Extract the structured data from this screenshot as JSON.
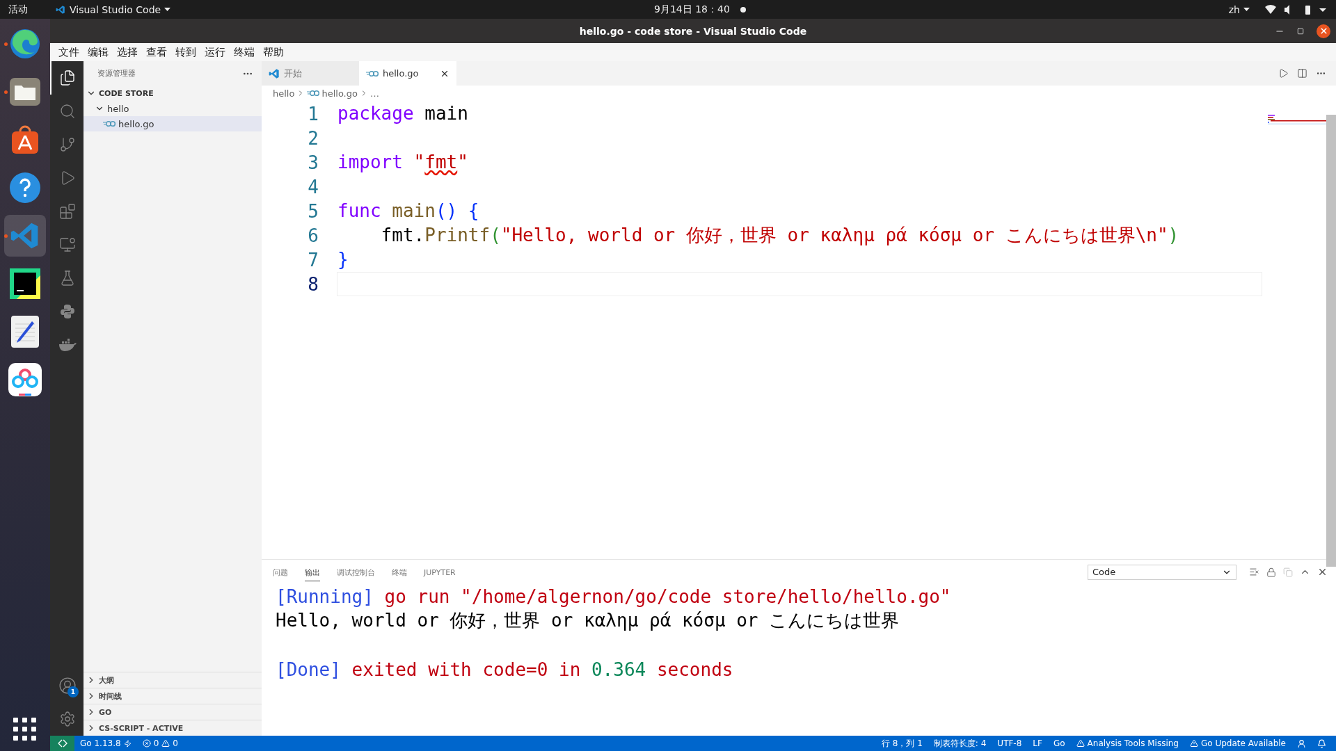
{
  "system_bar": {
    "activities": "活动",
    "app_name": "Visual Studio Code",
    "clock": "9月14日  18：40",
    "input_method": "zh"
  },
  "dock": {
    "apps": [
      {
        "kind": "edge",
        "running": true,
        "selected": false
      },
      {
        "kind": "files",
        "running": true,
        "selected": false
      },
      {
        "kind": "software",
        "running": false,
        "selected": false
      },
      {
        "kind": "help",
        "running": false,
        "selected": false
      },
      {
        "kind": "vscode",
        "running": true,
        "selected": true
      },
      {
        "kind": "pycharm",
        "running": false,
        "selected": false
      },
      {
        "kind": "editor",
        "running": false,
        "selected": false
      },
      {
        "kind": "netdisk",
        "running": false,
        "selected": false
      }
    ]
  },
  "window": {
    "title": "hello.go - code store - Visual Studio Code"
  },
  "menu": [
    "文件",
    "编辑",
    "选择",
    "查看",
    "转到",
    "运行",
    "终端",
    "帮助"
  ],
  "activity_bar": {
    "items": [
      {
        "kind": "explorer",
        "selected": true
      },
      {
        "kind": "search",
        "selected": false
      },
      {
        "kind": "source_control",
        "selected": false
      },
      {
        "kind": "run",
        "selected": false
      },
      {
        "kind": "extensions",
        "selected": false
      },
      {
        "kind": "remote",
        "selected": false
      },
      {
        "kind": "testing",
        "selected": false
      },
      {
        "kind": "python",
        "selected": false
      },
      {
        "kind": "docker",
        "selected": false
      }
    ],
    "account_badge": "1"
  },
  "sidebar": {
    "title": "资源管理器",
    "tree": [
      {
        "label": "CODE STORE",
        "kind": "root",
        "expanded": true,
        "selected": false,
        "children": [
          {
            "label": "hello",
            "kind": "folder",
            "expanded": true,
            "selected": false,
            "children": [
              {
                "label": "hello.go",
                "kind": "go",
                "expanded": false,
                "selected": true
              }
            ]
          }
        ]
      }
    ],
    "sections": [
      {
        "label": "大纲",
        "expanded": false
      },
      {
        "label": "时间线",
        "expanded": false
      },
      {
        "label": "GO",
        "expanded": false
      },
      {
        "label": "CS-SCRIPT - ACTIVE",
        "expanded": false
      }
    ]
  },
  "tabs": [
    {
      "label": "开始",
      "kind": "welcome",
      "selected": false
    },
    {
      "label": "hello.go",
      "kind": "go",
      "selected": true
    }
  ],
  "breadcrumb": [
    {
      "label": "hello",
      "kind": "folder"
    },
    {
      "label": "hello.go",
      "kind": "go"
    },
    {
      "label": "…",
      "kind": "symbol"
    }
  ],
  "editor": {
    "lines": [
      {
        "number": "1",
        "current": false,
        "tokens": [
          {
            "kind": "keyword",
            "text": "package"
          },
          {
            "kind": "plain",
            "text": " main"
          }
        ]
      },
      {
        "number": "2",
        "current": false
      },
      {
        "number": "3",
        "current": false,
        "tokens": [
          {
            "kind": "keyword",
            "text": "import "
          },
          {
            "kind": "string",
            "text": "\""
          },
          {
            "kind": "string_flagged",
            "text": "fmt"
          },
          {
            "kind": "string",
            "text": "\""
          }
        ]
      },
      {
        "number": "4",
        "current": false
      },
      {
        "number": "5",
        "current": false,
        "tokens": [
          {
            "kind": "keyword",
            "text": "func "
          },
          {
            "kind": "function",
            "text": "main"
          },
          {
            "kind": "bracket",
            "text": "() {"
          }
        ]
      },
      {
        "number": "6",
        "current": false,
        "tokens": [
          {
            "kind": "plain",
            "text": "    fmt."
          },
          {
            "kind": "function",
            "text": "Printf"
          },
          {
            "kind": "bracket2",
            "text": "("
          },
          {
            "kind": "string",
            "text": "\"Hello, world or 你好，世界 or καλημ ρά κόσμ or こんにちは世界\\n\""
          },
          {
            "kind": "bracket2",
            "text": ")"
          }
        ]
      },
      {
        "number": "7",
        "current": false,
        "tokens": [
          {
            "kind": "bracket",
            "text": "}"
          }
        ]
      },
      {
        "number": "8",
        "current": true
      }
    ]
  },
  "panel": {
    "tabs": [
      {
        "label": "问题",
        "selected": false
      },
      {
        "label": "输出",
        "selected": true
      },
      {
        "label": "调试控制台",
        "selected": false
      },
      {
        "label": "终端",
        "selected": false
      },
      {
        "label": "JUPYTER",
        "selected": false
      }
    ],
    "output_channel": "Code",
    "lines": [
      {
        "kind": "text",
        "segments": [
          {
            "kind": "info",
            "text": "[Running]"
          },
          {
            "kind": "error",
            "text": " go run \"/home/algernon/go/code store/hello/hello.go\""
          }
        ]
      },
      {
        "kind": "text",
        "segments": [
          {
            "kind": "plain",
            "text": "Hello, world or 你好，世界 or καλημ ρά κόσμ or こんにちは世界"
          }
        ]
      },
      {
        "kind": "blank"
      },
      {
        "kind": "text",
        "segments": [
          {
            "kind": "info",
            "text": "[Done]"
          },
          {
            "kind": "error",
            "text": " exited with code=0 in "
          },
          {
            "kind": "number",
            "text": "0.364"
          },
          {
            "kind": "error",
            "text": " seconds"
          }
        ]
      }
    ]
  },
  "status_bar": {
    "left": [
      {
        "kind": "remote"
      },
      {
        "kind": "go_version",
        "text": "Go 1.13.8"
      },
      {
        "kind": "problems",
        "errors": "0",
        "warnings": "0"
      }
    ],
    "right": [
      {
        "kind": "text",
        "text": "行 8，列 1"
      },
      {
        "kind": "text",
        "text": "制表符长度: 4"
      },
      {
        "kind": "text",
        "text": "UTF-8"
      },
      {
        "kind": "text",
        "text": "LF"
      },
      {
        "kind": "text",
        "text": "Go"
      },
      {
        "kind": "warning",
        "text": "Analysis Tools Missing"
      },
      {
        "kind": "warning",
        "text": "Go Update Available"
      },
      {
        "kind": "feedback"
      },
      {
        "kind": "bell"
      }
    ]
  }
}
